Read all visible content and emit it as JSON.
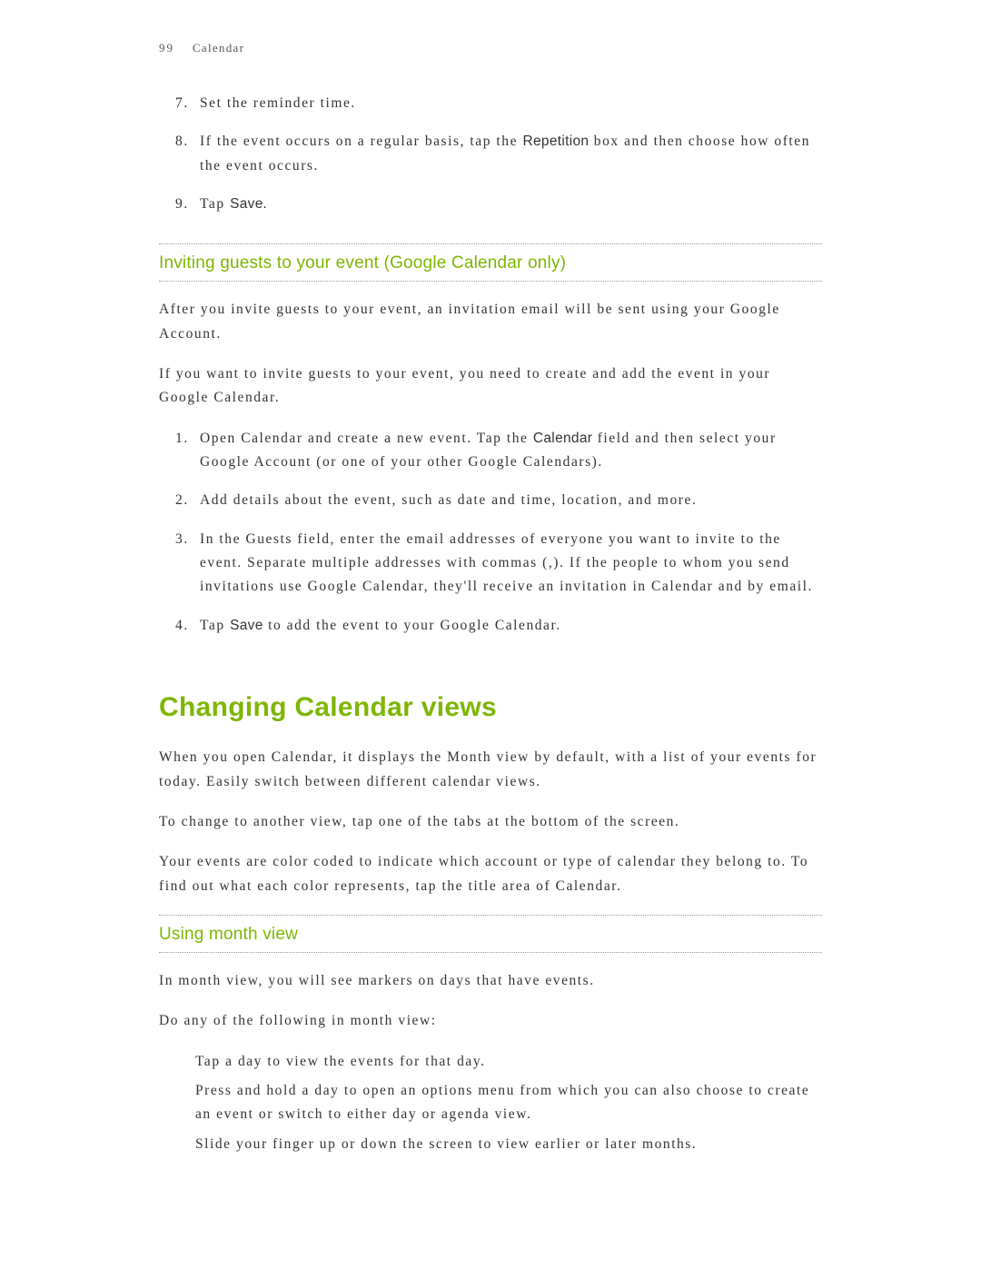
{
  "header": {
    "page_number": "99",
    "chapter": "Calendar"
  },
  "top_list": {
    "item7": "Set the reminder time.",
    "item8_pre": "If the event occurs on a regular basis, tap the ",
    "item8_bold": "Repetition",
    "item8_post": " box and then choose how often the event occurs.",
    "item9_pre": "Tap ",
    "item9_bold": "Save",
    "item9_post": "."
  },
  "section1": {
    "heading": "Inviting guests to your event (Google Calendar only)",
    "p1": "After you invite guests to your event, an invitation email will be sent using your Google Account.",
    "p2": "If you want to invite guests to your event, you need to create and add the event in your Google Calendar.",
    "list": {
      "item1_pre": "Open Calendar and create a new event. Tap the ",
      "item1_bold": "Calendar",
      "item1_post": " field and then select your Google Account (or one of your other Google Calendars).",
      "item2": "Add details about the event, such as date and time, location, and more.",
      "item3": "In the Guests field, enter the email addresses of everyone you want to invite to the event. Separate multiple addresses with commas (,). If the people to whom you send invitations use Google Calendar, they'll receive an invitation in Calendar and by email.",
      "item4_pre": "Tap ",
      "item4_bold": "Save",
      "item4_post": " to add the event to your Google Calendar."
    }
  },
  "section2": {
    "heading": "Changing Calendar views",
    "p1": "When you open Calendar, it displays the Month view by default, with a list of your events for today. Easily switch between different calendar views.",
    "p2": "To change to another view, tap one of the tabs at the bottom of the screen.",
    "p3": "Your events are color coded to indicate which account or type of calendar they belong to. To find out what each color represents, tap the title area of Calendar."
  },
  "section3": {
    "heading": "Using month view",
    "p1": "In month view, you will see markers on days that have events.",
    "p2": "Do any of the following in month view:",
    "list": {
      "item1": "Tap a day to view the events for that day.",
      "item2": "Press and hold a day to open an options menu from which you can also choose to create an event or switch to either day or agenda view.",
      "item3": "Slide your finger up or down the screen to view earlier or later months."
    }
  }
}
